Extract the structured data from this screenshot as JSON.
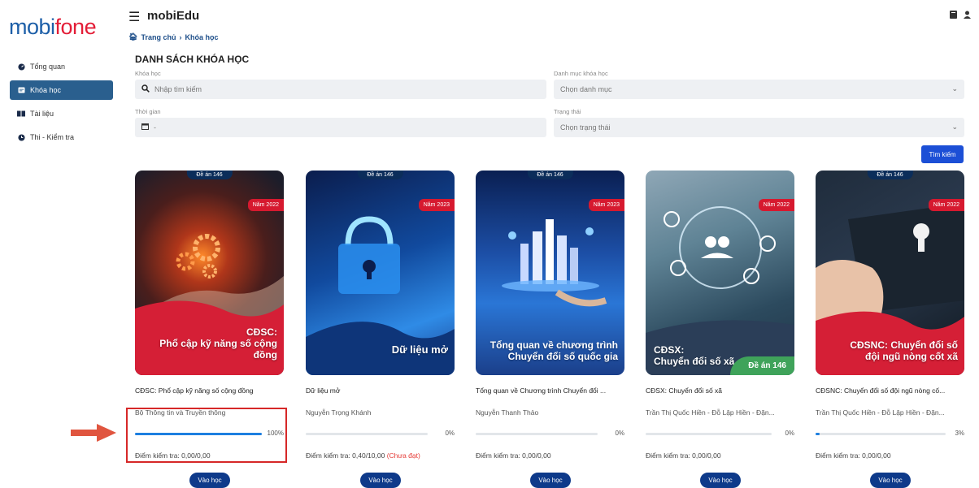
{
  "brand": {
    "logo_part1": "mobi",
    "logo_part2": "fone"
  },
  "sidebar": {
    "items": [
      {
        "label": "Tổng quan",
        "icon": "dashboard-icon"
      },
      {
        "label": "Khóa học",
        "icon": "course-icon"
      },
      {
        "label": "Tài liệu",
        "icon": "book-icon"
      },
      {
        "label": "Thi - Kiểm tra",
        "icon": "clock-icon"
      }
    ]
  },
  "header": {
    "title": "mobiEdu",
    "breadcrumb": [
      "Trang chủ",
      "Khóa học"
    ]
  },
  "main": {
    "title": "DANH SÁCH KHÓA HỌC",
    "filters": {
      "course_label": "Khóa học",
      "course_placeholder": "Nhập tìm kiếm",
      "category_label": "Danh mục khóa học",
      "category_value": "Chọn danh mục",
      "time_label": "Thời gian",
      "time_value": "-",
      "status_label": "Trạng thái",
      "status_value": "Chọn trạng thái",
      "search_button": "Tìm kiếm"
    },
    "learn_button": "Vào học",
    "courses": [
      {
        "tag": "Đề án 146",
        "year": "Năm 2022",
        "cover_title_1": "CĐSC:",
        "cover_title_2": "Phổ cập kỹ năng số cộng đồng",
        "title": "CĐSC: Phổ cập kỹ năng số cộng đồng",
        "author": "Bộ Thông tin và Truyền thông",
        "progress": 100,
        "progress_label": "100%",
        "score_label": "Điểm kiểm tra: 0,00/0,00",
        "score_note": ""
      },
      {
        "tag": "Đề án 146",
        "year": "Năm 2023",
        "cover_title_1": "Dữ liệu mở",
        "cover_title_2": "",
        "title": "Dữ liệu mở",
        "author": "Nguyễn Trọng Khánh",
        "progress": 0,
        "progress_label": "0%",
        "score_label": "Điểm kiểm tra: 0,40/10,00",
        "score_note": "(Chưa đạt)"
      },
      {
        "tag": "Đề án 146",
        "year": "Năm 2023",
        "cover_title_1": "Tổng quan về chương trình",
        "cover_title_2": "Chuyển đổi số quốc gia",
        "title": "Tổng quan về Chương trình Chuyển đổi ...",
        "author": "Nguyễn Thanh Thảo",
        "progress": 0,
        "progress_label": "0%",
        "score_label": "Điểm kiểm tra: 0,00/0,00",
        "score_note": ""
      },
      {
        "tag": "",
        "year": "Năm 2022",
        "cover_title_1": "CĐSX:",
        "cover_title_2": "Chuyển đổi số xã",
        "badge": "Đề án 146",
        "title": "CĐSX: Chuyển đổi số xã",
        "author": "Trần Thị Quốc Hiền - Đỗ Lập Hiền - Đặn...",
        "progress": 0,
        "progress_label": "0%",
        "score_label": "Điểm kiểm tra: 0,00/0,00",
        "score_note": ""
      },
      {
        "tag": "Đề án 146",
        "year": "Năm 2022",
        "cover_title_1": "CĐSNC: Chuyển đổi số",
        "cover_title_2": "đội ngũ nòng cốt xã",
        "title": "CĐSNC: Chuyển đổi số đội ngũ nòng cố...",
        "author": "Trần Thị Quốc Hiền - Đỗ Lập Hiền - Đặn...",
        "progress": 3,
        "progress_label": "3%",
        "score_label": "Điểm kiểm tra: 0,00/0,00",
        "score_note": ""
      }
    ]
  },
  "colors": {
    "brand_blue": "#1d5fa8",
    "brand_red": "#e31d37",
    "active_nav": "#2a5f8e",
    "progress": "#1d7fe0",
    "button": "#0e3a8a",
    "highlight": "#d62828"
  }
}
